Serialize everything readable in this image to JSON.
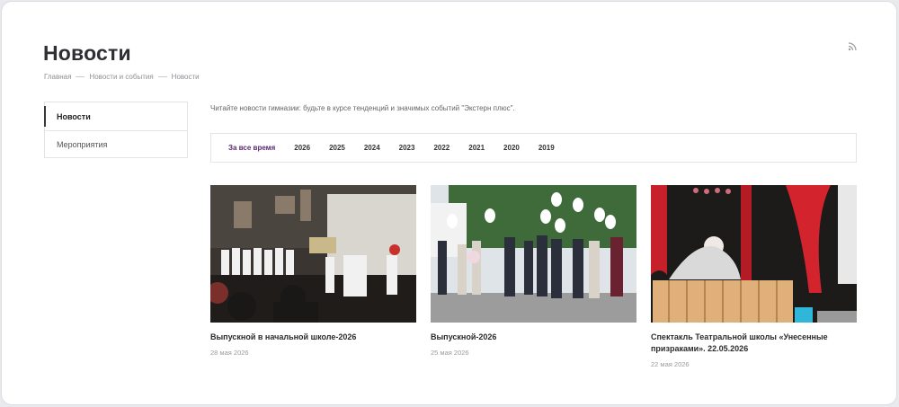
{
  "page": {
    "title": "Новости",
    "icons": {
      "rss": "rss-icon"
    }
  },
  "breadcrumb": [
    "Главная",
    "Новости и события",
    "Новости"
  ],
  "sidebar": {
    "items": [
      {
        "label": "Новости",
        "active": true
      },
      {
        "label": "Мероприятия",
        "active": false
      }
    ]
  },
  "intro": "Читайте новости гимназии: будьте в курсе тенденций и значимых событий \"Экстерн плюс\".",
  "year_filter": {
    "tabs": [
      "За все время",
      "2026",
      "2025",
      "2024",
      "2023",
      "2022",
      "2021",
      "2020",
      "2019"
    ],
    "selected": "За все время",
    "accent": "#5a2a72"
  },
  "news": [
    {
      "title": "Выпускной в начальной школе-2026",
      "date": "28 мая 2026",
      "image": "graduation-ceremony-stage-photo"
    },
    {
      "title": "Выпускной-2026",
      "date": "25 мая 2026",
      "image": "graduates-with-balloons-photo"
    },
    {
      "title": "Спектакль Театральной школы «Унесенные призраками». 22.05.2026",
      "date": "22 мая 2026",
      "image": "theatre-performance-photo"
    }
  ]
}
